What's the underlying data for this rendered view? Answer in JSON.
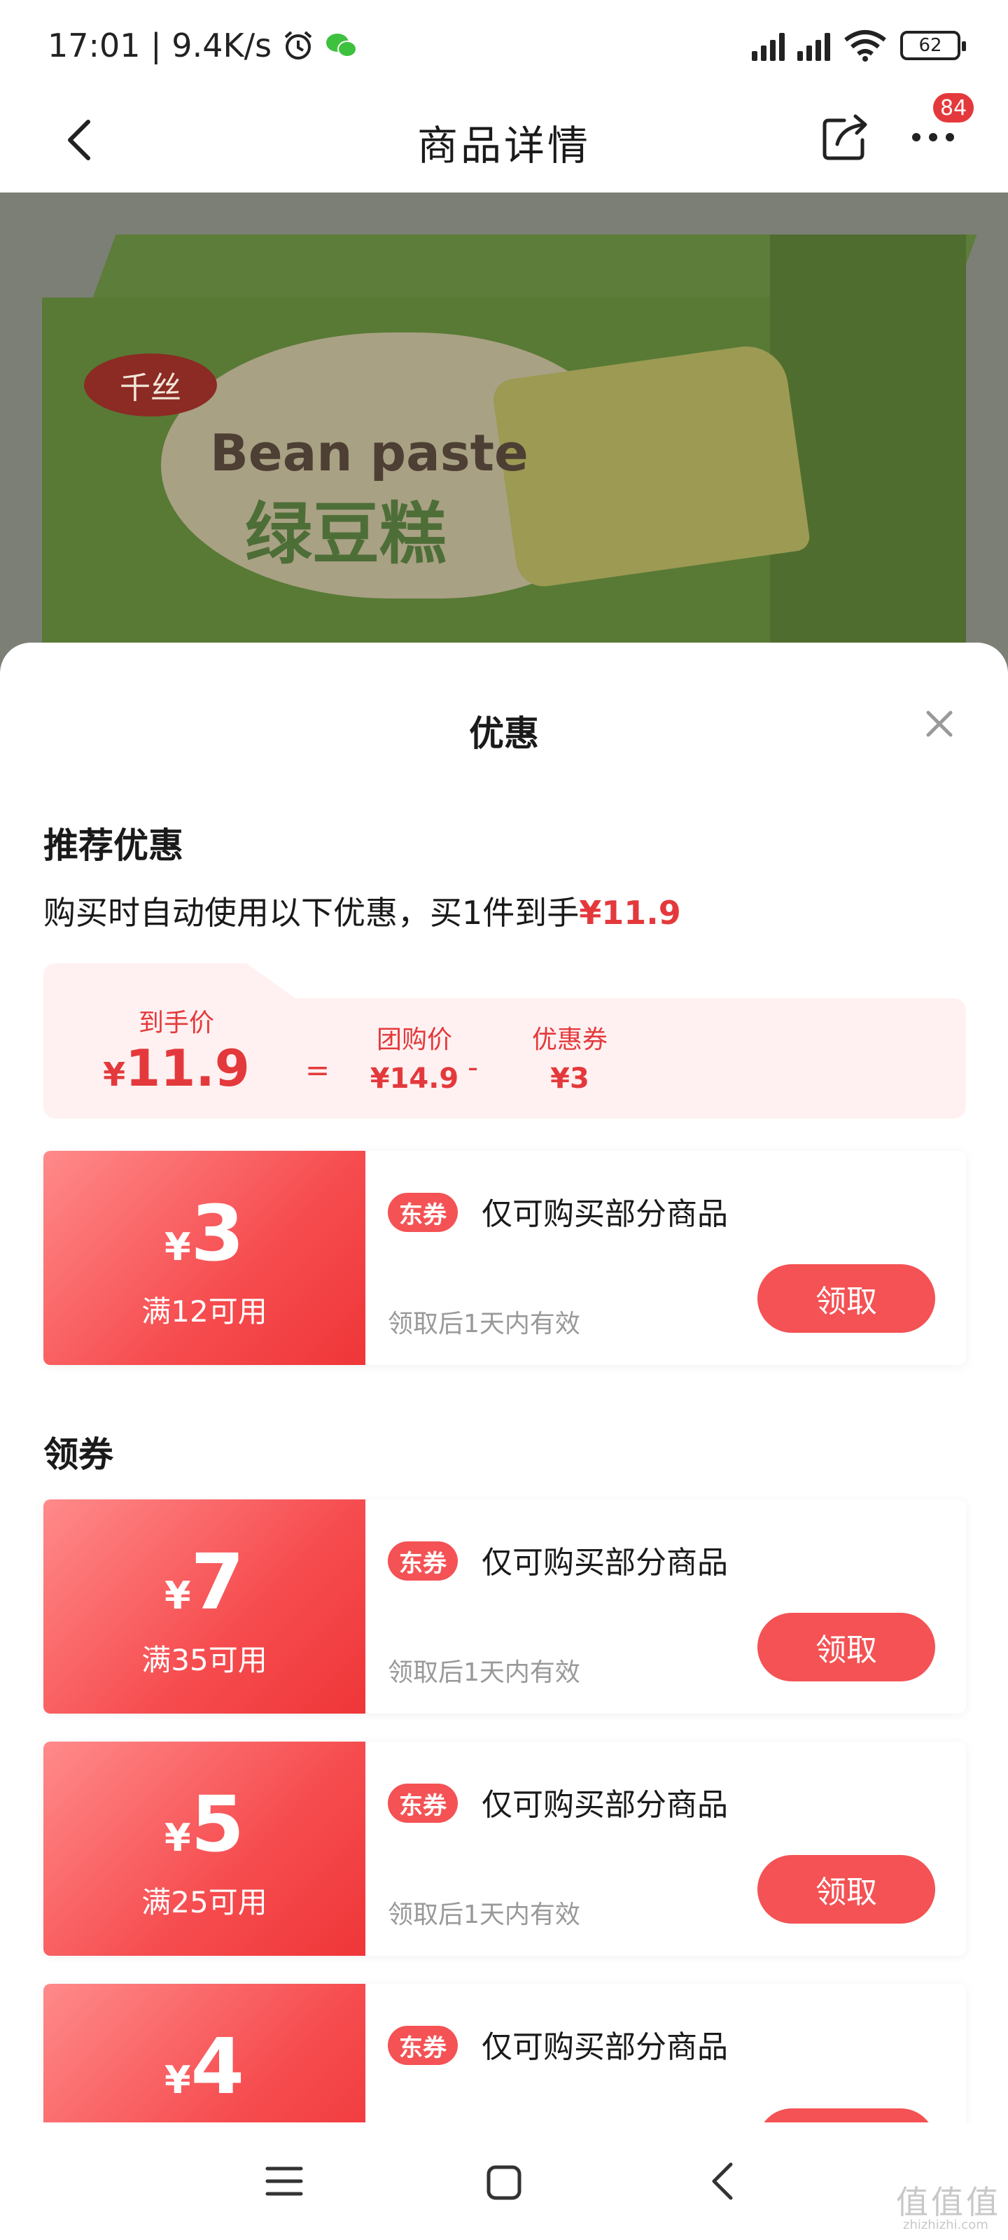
{
  "status_bar": {
    "time_speed": "17:01 | 9.4K/s",
    "battery": "62"
  },
  "header": {
    "title": "商品详情",
    "badge_count": "84"
  },
  "product_image": {
    "brand_logo_text": "千丝",
    "text_en": "Bean paste",
    "text_cn": "绿豆糕"
  },
  "sheet": {
    "title": "优惠",
    "recommended": {
      "heading": "推荐优惠",
      "description": "购买时自动使用以下优惠，买1件到手",
      "description_price": "¥11.9",
      "calc": {
        "final_label": "到手价",
        "final_yen": "¥",
        "final_value": "11.9",
        "equals": "=",
        "group_label": "团购价",
        "group_value": "¥14.9",
        "minus": "-",
        "coupon_label": "优惠券",
        "coupon_value": "¥3"
      },
      "coupon": {
        "yen": "¥",
        "amount": "3",
        "condition": "满12可用",
        "tag": "东券",
        "name": "仅可购买部分商品",
        "validity": "领取后1天内有效",
        "button": "领取"
      }
    },
    "claim_section": {
      "heading": "领券",
      "coupons": [
        {
          "yen": "¥",
          "amount": "7",
          "condition": "满35可用",
          "tag": "东券",
          "name": "仅可购买部分商品",
          "validity": "领取后1天内有效",
          "button": "领取"
        },
        {
          "yen": "¥",
          "amount": "5",
          "condition": "满25可用",
          "tag": "东券",
          "name": "仅可购买部分商品",
          "validity": "领取后1天内有效",
          "button": "领取"
        },
        {
          "yen": "¥",
          "amount": "4",
          "condition": "",
          "tag": "东券",
          "name": "仅可购买部分商品",
          "validity": "",
          "button": ""
        }
      ]
    }
  },
  "watermark": {
    "main": "值值值",
    "sub": "zhizhizhi.com"
  },
  "colors": {
    "accent": "#e4393c",
    "coupon_button": "#f45254",
    "calc_background": "#fff1f1"
  }
}
